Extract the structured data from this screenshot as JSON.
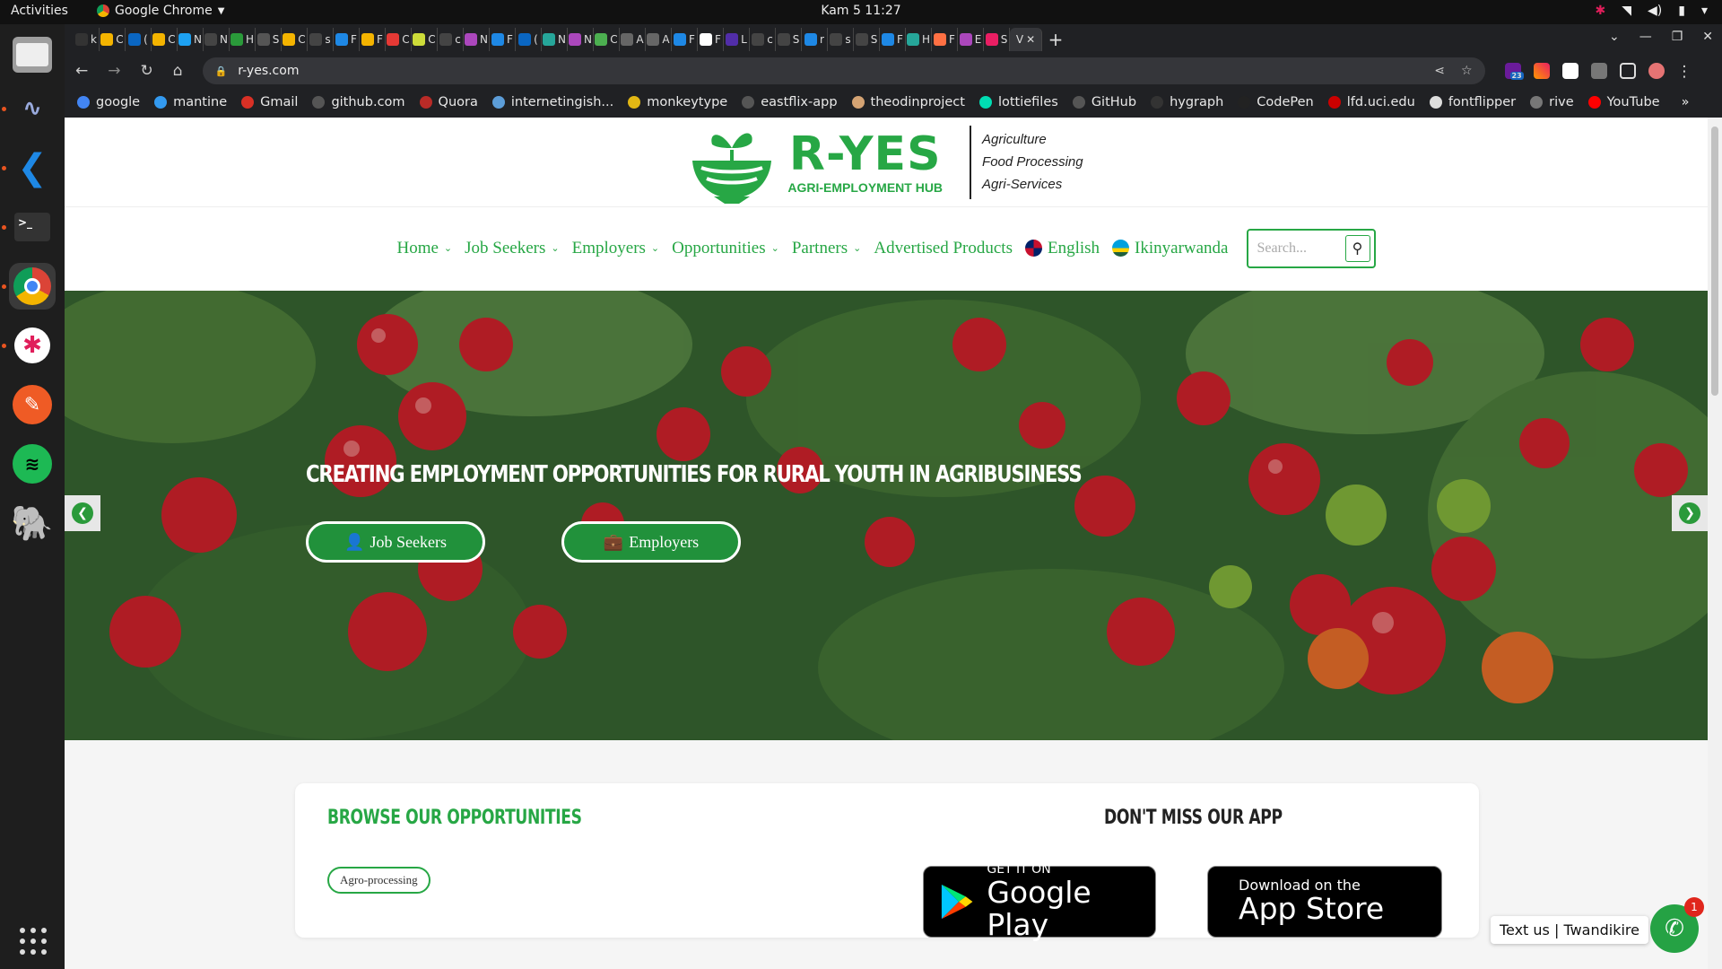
{
  "system": {
    "activities": "Activities",
    "app_name": "Google Chrome",
    "clock": "Kam 5  11:27"
  },
  "browser": {
    "url": "r-yes.com",
    "tabs": [
      {
        "label": "k",
        "color": "#333"
      },
      {
        "label": "C",
        "color": "#f4b400"
      },
      {
        "label": "(",
        "color": "#0a66c2"
      },
      {
        "label": "C",
        "color": "#f4b400"
      },
      {
        "label": "N",
        "color": "#1da1f2"
      },
      {
        "label": "N",
        "color": "#444"
      },
      {
        "label": "H",
        "color": "#2a9a3a"
      },
      {
        "label": "S",
        "color": "#555"
      },
      {
        "label": "C",
        "color": "#f4b400"
      },
      {
        "label": "s",
        "color": "#444"
      },
      {
        "label": "F",
        "color": "#1e88e5"
      },
      {
        "label": "F",
        "color": "#f4b400"
      },
      {
        "label": "C",
        "color": "#e53935"
      },
      {
        "label": "C",
        "color": "#cddc39"
      },
      {
        "label": "c",
        "color": "#444"
      },
      {
        "label": "N",
        "color": "#ab47bc"
      },
      {
        "label": "F",
        "color": "#1e88e5"
      },
      {
        "label": "(",
        "color": "#0a66c2"
      },
      {
        "label": "N",
        "color": "#26a69a"
      },
      {
        "label": "N",
        "color": "#ab47bc"
      },
      {
        "label": "C",
        "color": "#4caf50"
      },
      {
        "label": "A",
        "color": "#666"
      },
      {
        "label": "A",
        "color": "#666"
      },
      {
        "label": "F",
        "color": "#1e88e5"
      },
      {
        "label": "F",
        "color": "#ffffff"
      },
      {
        "label": "L",
        "color": "#512da8"
      },
      {
        "label": "c",
        "color": "#444"
      },
      {
        "label": "S",
        "color": "#444"
      },
      {
        "label": "r",
        "color": "#1e88e5"
      },
      {
        "label": "s",
        "color": "#444"
      },
      {
        "label": "S",
        "color": "#444"
      },
      {
        "label": "F",
        "color": "#1e88e5"
      },
      {
        "label": "H",
        "color": "#26a69a"
      },
      {
        "label": "F",
        "color": "#ff7043"
      },
      {
        "label": "E",
        "color": "#ab47bc"
      },
      {
        "label": "S",
        "color": "#e91e63"
      }
    ],
    "current_tab": "V",
    "bookmarks": [
      {
        "label": "google",
        "color": "#4285f4"
      },
      {
        "label": "mantine",
        "color": "#339af0"
      },
      {
        "label": "Gmail",
        "color": "#d93025"
      },
      {
        "label": "github.com",
        "color": "#555"
      },
      {
        "label": "Quora",
        "color": "#b92b27"
      },
      {
        "label": "internetingish...",
        "color": "#5c9dd8"
      },
      {
        "label": "monkeytype",
        "color": "#e2b714"
      },
      {
        "label": "eastflix-app",
        "color": "#555"
      },
      {
        "label": "theodinproject",
        "color": "#d4a373"
      },
      {
        "label": "lottiefiles",
        "color": "#00ddb3"
      },
      {
        "label": "GitHub",
        "color": "#555"
      },
      {
        "label": "hygraph",
        "color": "#333"
      },
      {
        "label": "CodePen",
        "color": "#222"
      },
      {
        "label": "lfd.uci.edu",
        "color": "#c00"
      },
      {
        "label": "fontflipper",
        "color": "#ddd"
      },
      {
        "label": "rive",
        "color": "#777"
      },
      {
        "label": "YouTube",
        "color": "#ff0000"
      }
    ],
    "more": "»",
    "ext_badge": "23"
  },
  "site": {
    "brand": "R-YES",
    "brand_sub": "AGRI-EMPLOYMENT HUB",
    "taglines": [
      "Agriculture",
      "Food Processing",
      "Agri-Services"
    ],
    "nav": [
      {
        "label": "Home",
        "dropdown": true
      },
      {
        "label": "Job Seekers",
        "dropdown": true
      },
      {
        "label": "Employers",
        "dropdown": true
      },
      {
        "label": "Opportunities",
        "dropdown": true
      },
      {
        "label": "Partners",
        "dropdown": true
      },
      {
        "label": "Advertised Products",
        "dropdown": false
      }
    ],
    "lang_en": "English",
    "lang_rw": "Ikinyarwanda",
    "search_placeholder": "Search...",
    "hero_title": "CREATING EMPLOYMENT OPPORTUNITIES FOR RURAL YOUTH IN AGRIBUSINESS",
    "hero_btn_jobseekers": "Job Seekers",
    "hero_btn_employers": "Employers",
    "browse_title": "BROWSE OUR OPPORTUNITIES",
    "app_title": "DON'T MISS OUR APP",
    "chip": "Agro-processing",
    "gplay_small": "GET IT ON",
    "gplay_big": "Google Play",
    "appstore_small": "Download on the",
    "appstore_big": "App Store",
    "chat_text": "Text us | Twandikire",
    "chat_badge": "1",
    "accent": "#27a745"
  }
}
